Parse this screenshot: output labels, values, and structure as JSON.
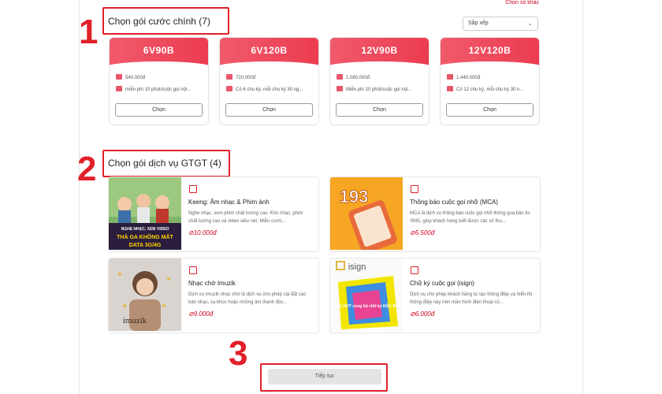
{
  "top_link": "Chọn số khác",
  "steps": [
    "1",
    "2",
    "3"
  ],
  "main_section": {
    "title": "Chọn gói cước chính (7)",
    "sort_label": "Sắp xếp"
  },
  "plans": [
    {
      "name": "6V90B",
      "price": "540.000đ",
      "desc": "miễn phí 10 phút/cuộc gọi nội...",
      "button": "Chọn"
    },
    {
      "name": "6V120B",
      "price": "720.000đ",
      "desc": "Có 6 chu kỳ, mỗi chu kỳ 30 ng...",
      "button": "Chọn"
    },
    {
      "name": "12V90B",
      "price": "1.080.000đ",
      "desc": "Miễn phí 10 phút/cuộc gọi nội...",
      "button": "Chọn"
    },
    {
      "name": "12V120B",
      "price": "1.440.000đ",
      "desc": "Có 12 chu kỳ, mỗi chu kỳ 30 n...",
      "button": "Chọn"
    }
  ],
  "vas_section": {
    "title": "Chọn gói dịch vụ GTGT (4)"
  },
  "services": [
    {
      "title": "Keeng: Âm nhạc & Phim ảnh",
      "desc": "Nghe nhạc, xem phim chất lượng cao. Kho nhạc, phim chất lượng cao và video siêu nét. Miễn cước...",
      "price": "10.000đ",
      "img_text": [
        "NGHE NHẠC, XEM VIDEO",
        "THẢ GA KHÔNG MẤT",
        "DATA 3G/4G"
      ]
    },
    {
      "title": "Thông báo cuộc gọi nhỡ (MCA)",
      "desc": "MCA là dịch vụ thông báo cuộc gọi nhỡ thông qua bản tin SMS, giúp khách hàng biết được các số thu...",
      "price": "5.500đ",
      "img_text": [
        "193"
      ]
    },
    {
      "title": "Nhạc chờ Imuzik",
      "desc": "Dịch vụ Imuzik nhạc chờ là dịch vụ cho phép cài đặt các bản nhạc, ca khúc hoặc những âm thanh độc...",
      "price": "9.000đ",
      "img_text": [
        "imuzik"
      ]
    },
    {
      "title": "Chữ ký cuộc gọi (isign)",
      "desc": "Dịch vụ cho phép khách hàng tự tạo thông điệp và hiển thị thông điệp này trên màn hình điện thoại củ...",
      "price": "6.000đ",
      "img_text": [
        "isign",
        "SIÊU HOT cùng bộ chữ ký ĐẶC BIỆT"
      ]
    }
  ],
  "continue_button": "Tiếp tục",
  "colors": {
    "accent": "#e0202a",
    "plan_header": "#ec3c50",
    "price": "#d0021b"
  }
}
